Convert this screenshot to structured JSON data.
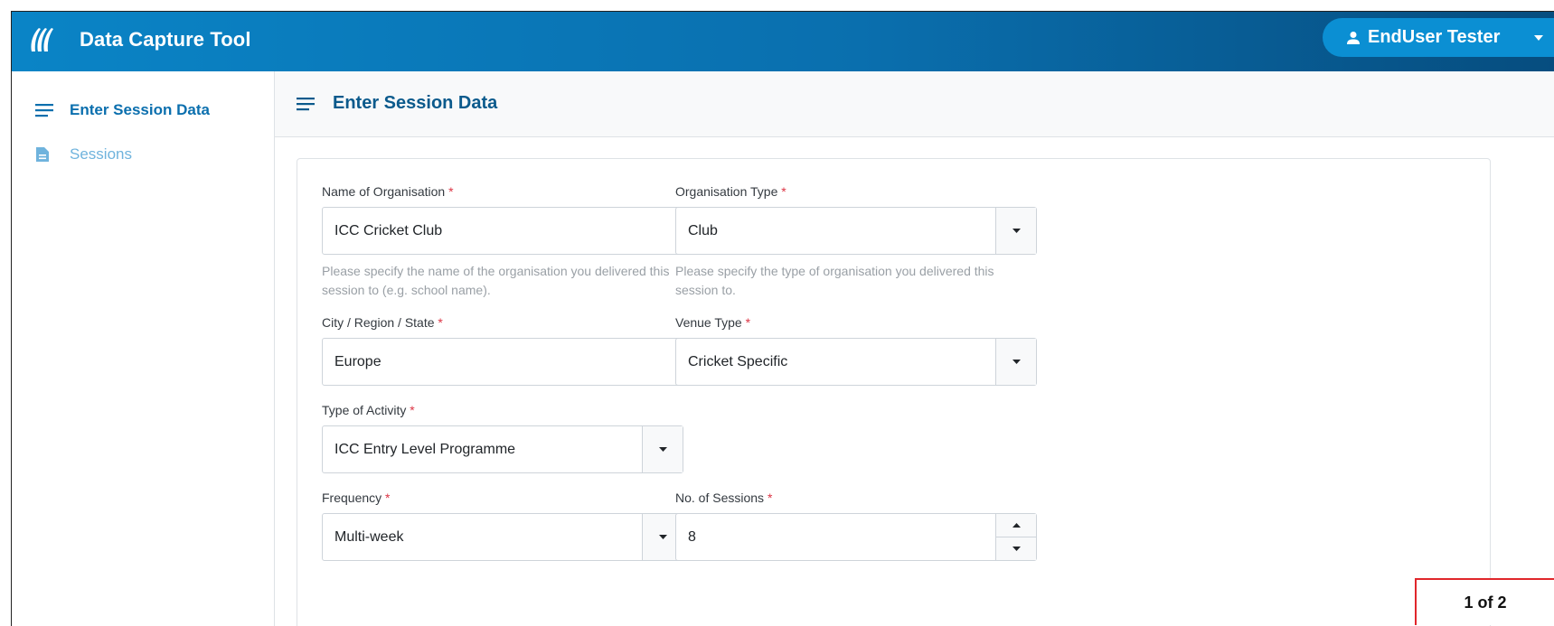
{
  "header": {
    "app_title": "Data Capture Tool",
    "user_name": "EndUser Tester",
    "logo_icon": "icc-logo-icon",
    "user_icon": "person-icon",
    "caret_icon": "caret-down-icon"
  },
  "sidebar": {
    "items": [
      {
        "label": "Enter Session Data",
        "icon": "menu-lines-icon",
        "active": true
      },
      {
        "label": "Sessions",
        "icon": "document-icon",
        "active": false
      }
    ]
  },
  "main": {
    "title": "Enter Session Data",
    "required_mark": "*",
    "fields": {
      "org_name": {
        "label": "Name of Organisation",
        "value": "ICC Cricket Club",
        "help": "Please specify the name of the organisation you delivered this session to (e.g. school name)."
      },
      "org_type": {
        "label": "Organisation Type",
        "value": "Club",
        "help": "Please specify the type of organisation you delivered this session to."
      },
      "city": {
        "label": "City / Region / State",
        "value": "Europe"
      },
      "venue": {
        "label": "Venue Type",
        "value": "Cricket Specific"
      },
      "activity": {
        "label": "Type of Activity",
        "value": "ICC Entry Level Programme"
      },
      "frequency": {
        "label": "Frequency",
        "value": "Multi-week"
      },
      "sessions": {
        "label": "No. of Sessions",
        "value": "8"
      }
    }
  },
  "page_indicator": "1 of 2",
  "colors": {
    "header_start": "#0a84c6",
    "header_end": "#064d7f",
    "accent": "#0b6fae",
    "required": "#dc3545",
    "indicator_border": "#e0262b"
  }
}
